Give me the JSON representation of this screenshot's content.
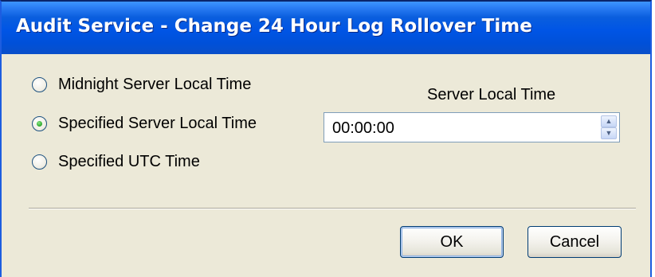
{
  "window": {
    "title": "Audit Service - Change 24 Hour Log Rollover Time"
  },
  "options": [
    {
      "label": "Midnight Server Local Time",
      "checked": false
    },
    {
      "label": "Specified Server Local Time",
      "checked": true
    },
    {
      "label": "Specified UTC Time",
      "checked": false
    }
  ],
  "time_field": {
    "label": "Server Local Time",
    "value": "00:00:00"
  },
  "buttons": {
    "ok_label": "OK",
    "cancel_label": "Cancel"
  },
  "colors": {
    "titlebar": "#0055e5",
    "dialog_background": "#ece9d8",
    "selected_radio": "#3cb43a"
  }
}
